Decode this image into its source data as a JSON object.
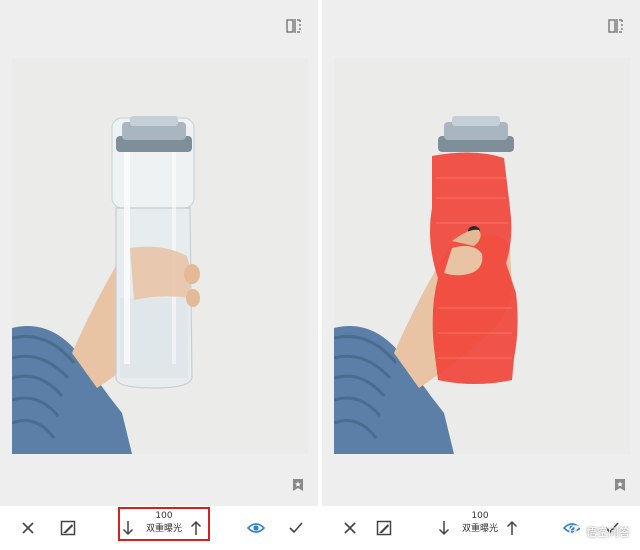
{
  "left_panel": {
    "toolbar": {
      "close_icon": "close-icon",
      "mask_icon": "mask-brush-icon",
      "decrease_icon": "arrow-down-icon",
      "value": "100",
      "tool_label": "双重曝光",
      "increase_icon": "arrow-up-icon",
      "view_icon": "eye-icon",
      "apply_icon": "check-icon"
    },
    "compare_icon": "compare-icon",
    "bookmark_icon": "bookmark-star-icon"
  },
  "right_panel": {
    "toolbar": {
      "close_icon": "close-icon",
      "mask_icon": "mask-brush-icon",
      "decrease_icon": "arrow-down-icon",
      "value": "100",
      "tool_label": "双重曝光",
      "increase_icon": "arrow-up-icon",
      "view_icon": "eye-icon",
      "apply_icon": "check-icon"
    },
    "compare_icon": "compare-icon",
    "bookmark_icon": "bookmark-star-icon",
    "mask_color": "#f0453a"
  },
  "watermark": {
    "text": "悟空问答"
  },
  "colors": {
    "accent": "#2f7fd9",
    "highlight_box": "#d81f1f",
    "sweater": "#5b7fa6",
    "cap": "#a9b6bf"
  }
}
